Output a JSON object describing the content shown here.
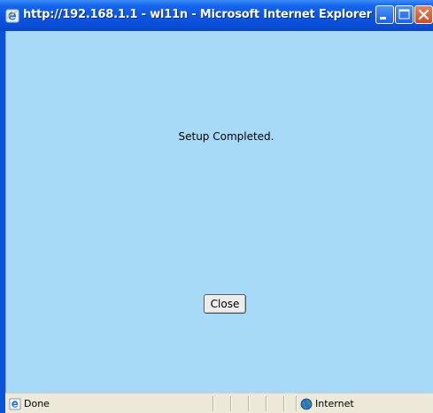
{
  "window": {
    "title": "http://192.168.1.1 - wl11n - Microsoft Internet Explorer"
  },
  "dialog": {
    "message": "Setup Completed.",
    "close_label": "Close"
  },
  "statusbar": {
    "status_text": "Done",
    "zone_text": "Internet"
  },
  "icons": {
    "title": "ie-icon",
    "minimize": "minimize-icon",
    "maximize": "maximize-icon",
    "close": "close-icon",
    "status": "page-done-icon",
    "zone": "internet-zone-icon"
  },
  "colors": {
    "titlebar": "#0b55e3",
    "client_background": "#a6daf7",
    "close_button_window": "#d64a22",
    "statusbar": "#ece9d8"
  }
}
